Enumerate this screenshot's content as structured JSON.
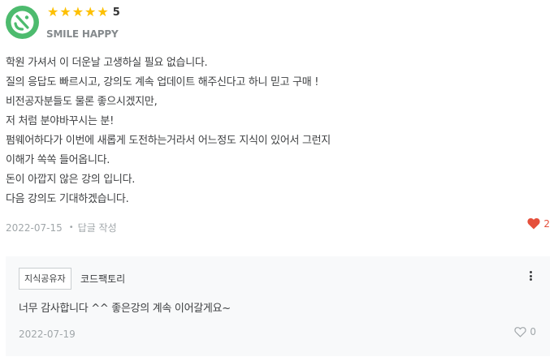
{
  "review": {
    "avatar_icon": "smile-happy-avatar-icon",
    "rating": "5",
    "star_count": 5,
    "star_color": "#fdc002",
    "username": "SMILE HAPPY",
    "body_lines": [
      "학원 가셔서 이 더운날 고생하실 필요 없습니다.",
      "질의 응답도 빠르시고, 강의도 계속 업데이트 해주신다고 하니 믿고 구매 !",
      "비전공자분들도 물론 좋으시겠지만,",
      "저 처럼 분야바꾸시는 분!",
      "펌웨어하다가 이번에 새롭게 도전하는거라서 어느정도 지식이 있어서 그런지",
      "이해가 쏙쏙 들어옵니다.",
      "돈이 아깝지 않은 강의 입니다.",
      "다음 강의도 기대하겠습니다."
    ],
    "date": "2022-07-15",
    "reply_label": "답글 작성",
    "like_count": "2",
    "like_icon": "heart-filled-icon",
    "like_color": "#e5503c"
  },
  "comment": {
    "role_badge": "지식공유자",
    "author": "코드팩토리",
    "text": "너무 감사합니다 ^^ 좋은강의 계속 이어갈게요~",
    "date": "2022-07-19",
    "like_count": "0",
    "like_icon": "heart-outline-icon",
    "menu_icon": "more-vertical-icon",
    "background": "#f8f9fa"
  }
}
